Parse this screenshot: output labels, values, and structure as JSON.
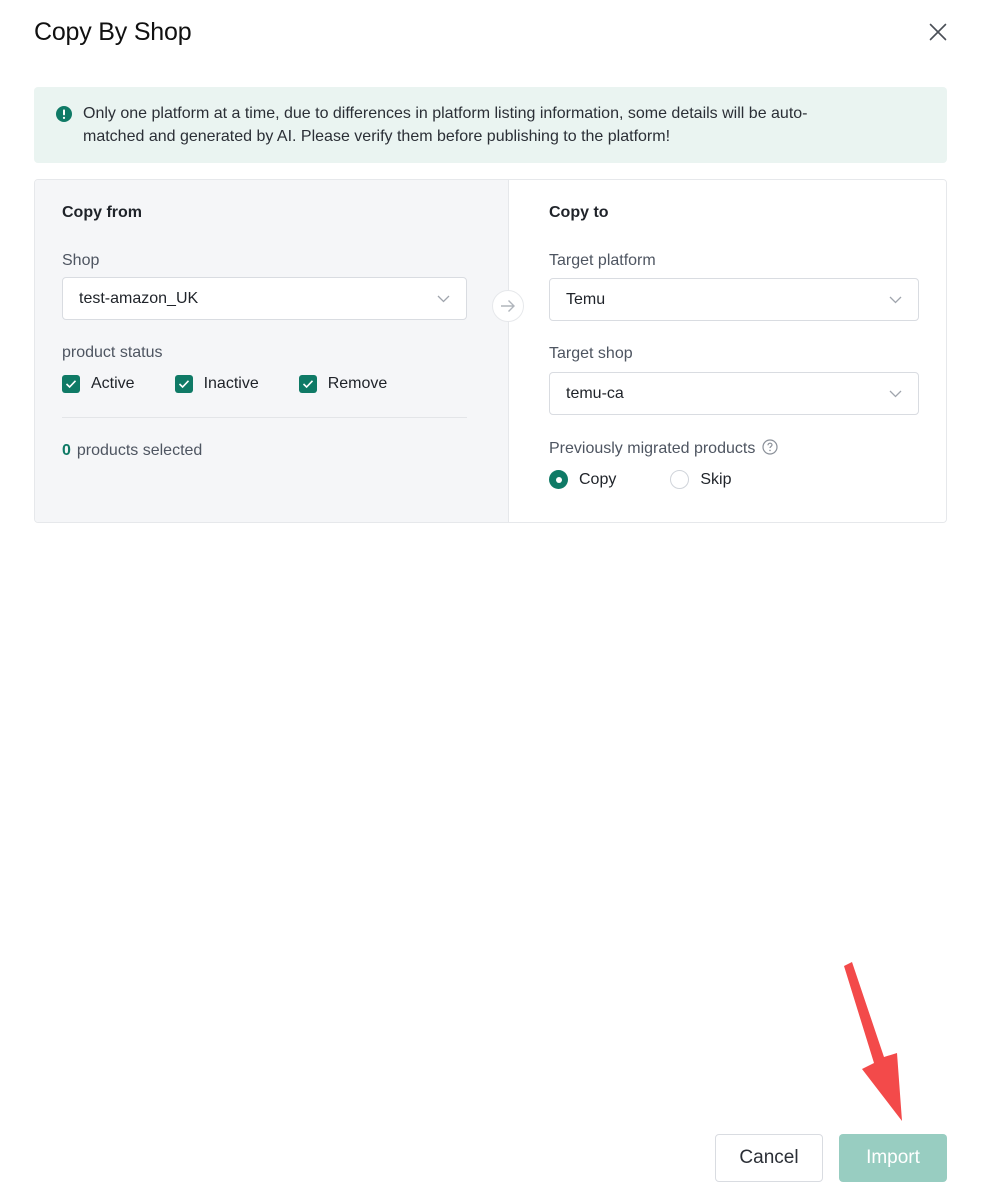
{
  "dialog": {
    "title": "Copy By Shop"
  },
  "notice": {
    "line1": "Only one platform at a time, due to differences in platform listing information, some details will be auto-",
    "line2": "matched and generated by AI. Please verify them before publishing to the platform!"
  },
  "copy_from": {
    "title": "Copy from",
    "shop_label": "Shop",
    "shop_value": "test-amazon_UK",
    "status_label": "product status",
    "statuses": [
      {
        "label": "Active",
        "checked": true
      },
      {
        "label": "Inactive",
        "checked": true
      },
      {
        "label": "Remove",
        "checked": true
      }
    ],
    "selected_count": "0",
    "selected_text": "products selected"
  },
  "copy_to": {
    "title": "Copy to",
    "platform_label": "Target platform",
    "platform_value": "Temu",
    "shop_label": "Target shop",
    "shop_value": "temu-ca",
    "migrated_label": "Previously migrated products",
    "options": [
      {
        "label": "Copy",
        "selected": true
      },
      {
        "label": "Skip",
        "selected": false
      }
    ]
  },
  "footer": {
    "cancel_label": "Cancel",
    "import_label": "Import"
  },
  "colors": {
    "accent": "#0f7a66",
    "notice_bg": "#eaf4f1",
    "import_disabled": "#98cdc1",
    "annotation_arrow": "#f34a4a"
  }
}
